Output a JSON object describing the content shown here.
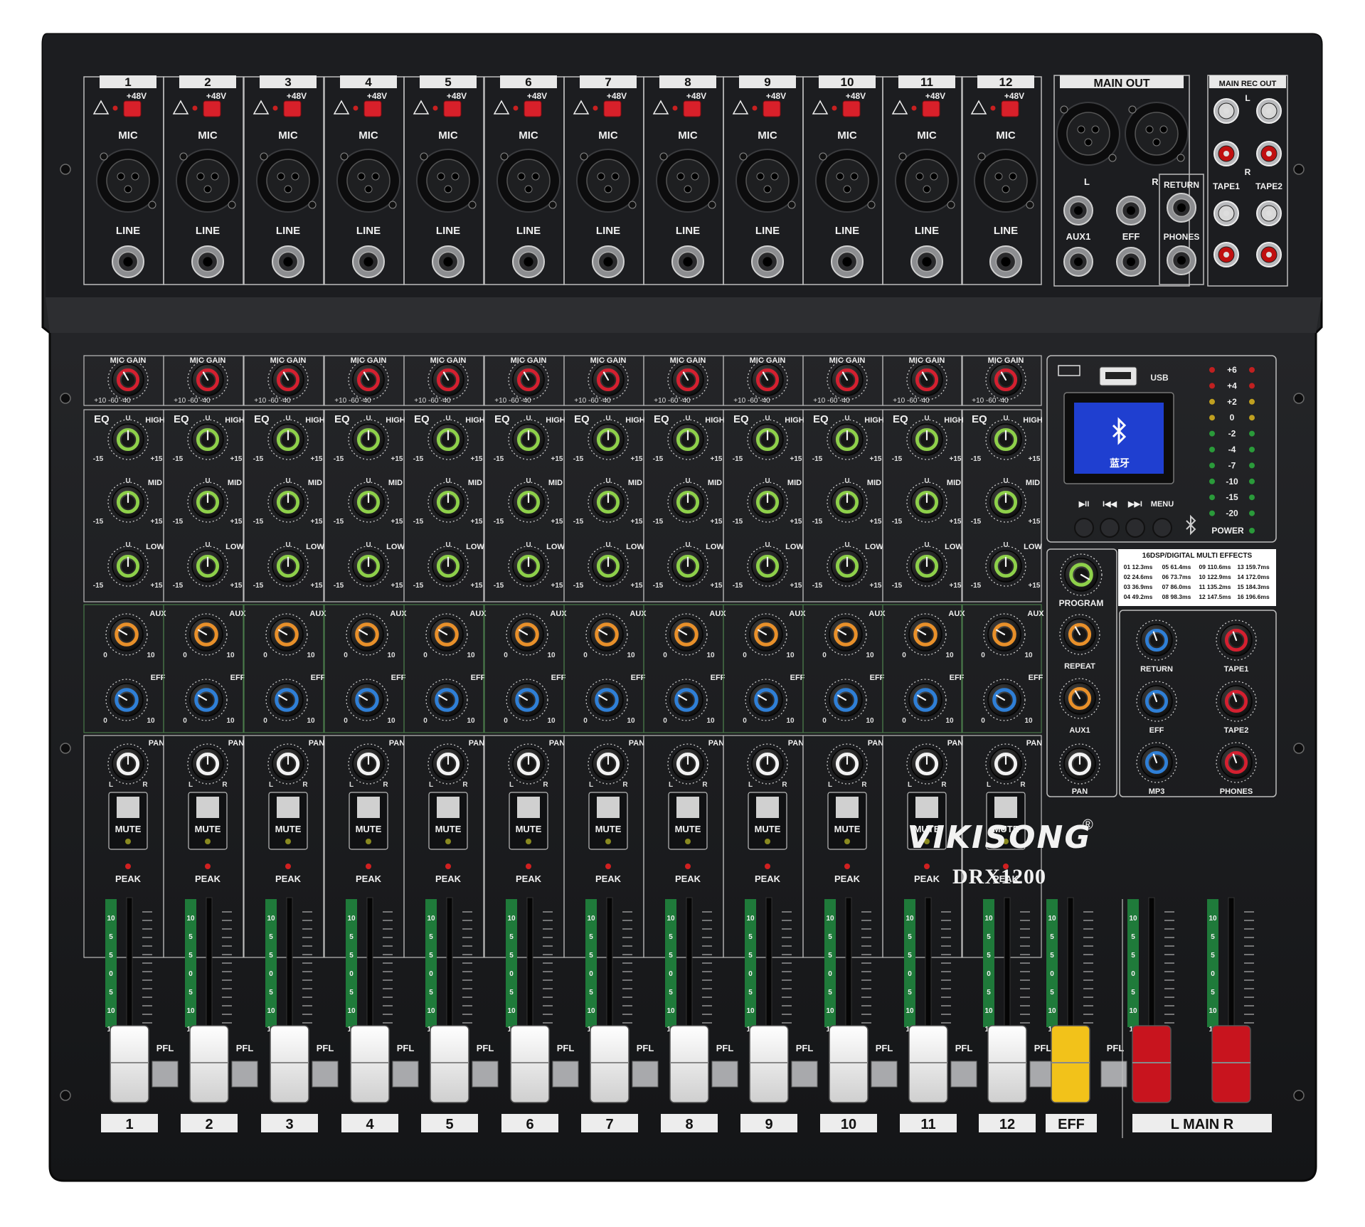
{
  "brand": "VIKISONG",
  "registered_mark": "®",
  "model": "DRX1200",
  "channels": [
    "1",
    "2",
    "3",
    "4",
    "5",
    "6",
    "7",
    "8",
    "9",
    "10",
    "11",
    "12"
  ],
  "input_labels": {
    "phantom": "+48V",
    "mic": "MIC",
    "line": "LINE"
  },
  "main_out": {
    "title": "MAIN OUT",
    "left": "L",
    "right": "R"
  },
  "rec_out": {
    "title": "MAIN  REC OUT",
    "left": "L",
    "right": "R",
    "tape1": "TAPE1",
    "tape2": "TAPE2"
  },
  "aux_jacks": {
    "aux1": "AUX1",
    "eff": "EFF",
    "return": "RETURN",
    "phones": "PHONES"
  },
  "strip_labels": {
    "mic_gain": "MIC GAIN",
    "gain_scale": [
      "+10",
      "+10",
      "-60",
      "-40"
    ],
    "eq": "EQ",
    "high": "HIGH",
    "mid": "MID",
    "low": "LOW",
    "u": "U",
    "eq_min": "-15",
    "eq_max": "+15",
    "aux": "AUX",
    "eff": "EFF",
    "send_min": "0",
    "send_max": "10",
    "pan": "PAN",
    "pan_l": "L",
    "pan_r": "R",
    "mute": "MUTE",
    "peak": "PEAK",
    "pfl": "PFL"
  },
  "fader_scale": [
    "10",
    "5",
    "5",
    "0",
    "5",
    "10",
    "15"
  ],
  "player": {
    "usb": "USB",
    "screen_text": "蓝牙",
    "buttons": [
      "▶II",
      "I◀◀",
      "▶▶I",
      "MENU"
    ]
  },
  "meter": {
    "levels": [
      "+6",
      "+4",
      "+2",
      "0",
      "-2",
      "-4",
      "-7",
      "-10",
      "-15",
      "-20"
    ],
    "power": "POWER"
  },
  "effects": {
    "title": "16DSP/DIGITAL MULTI EFFECTS",
    "presets": [
      [
        "01 12.3ms",
        "05 61.4ms",
        "09 110.6ms",
        "13 159.7ms"
      ],
      [
        "02 24.6ms",
        "06 73.7ms",
        "10 122.9ms",
        "14 172.0ms"
      ],
      [
        "03 36.9ms",
        "07 86.0ms",
        "11 135.2ms",
        "15 184.3ms"
      ],
      [
        "04 49.2ms",
        "08 98.3ms",
        "12 147.5ms",
        "16 196.6ms"
      ]
    ]
  },
  "effect_knobs": {
    "program": "PROGRAM",
    "repeat": "REPEAT",
    "aux1": "AUX1",
    "pan": "PAN"
  },
  "master_knobs": {
    "return": "RETURN",
    "tape1": "TAPE1",
    "eff": "EFF",
    "tape2": "TAPE2",
    "mp3": "MP3",
    "phones": "PHONES"
  },
  "bottom_labels": {
    "eff": "EFF",
    "main": "L  MAIN  R"
  },
  "colors": {
    "panel": "#1b1c1e",
    "gain_knob": "#d42030",
    "eq_knob": "#8ed04a",
    "aux_knob": "#e8902a",
    "eff_knob": "#2f7fd6",
    "pan_knob": "#f2f2f2",
    "meter_green": "#1f7a3a",
    "eff_fader": "#f2c21a",
    "main_fader": "#c8141e",
    "screen": "#1f3fd0"
  }
}
